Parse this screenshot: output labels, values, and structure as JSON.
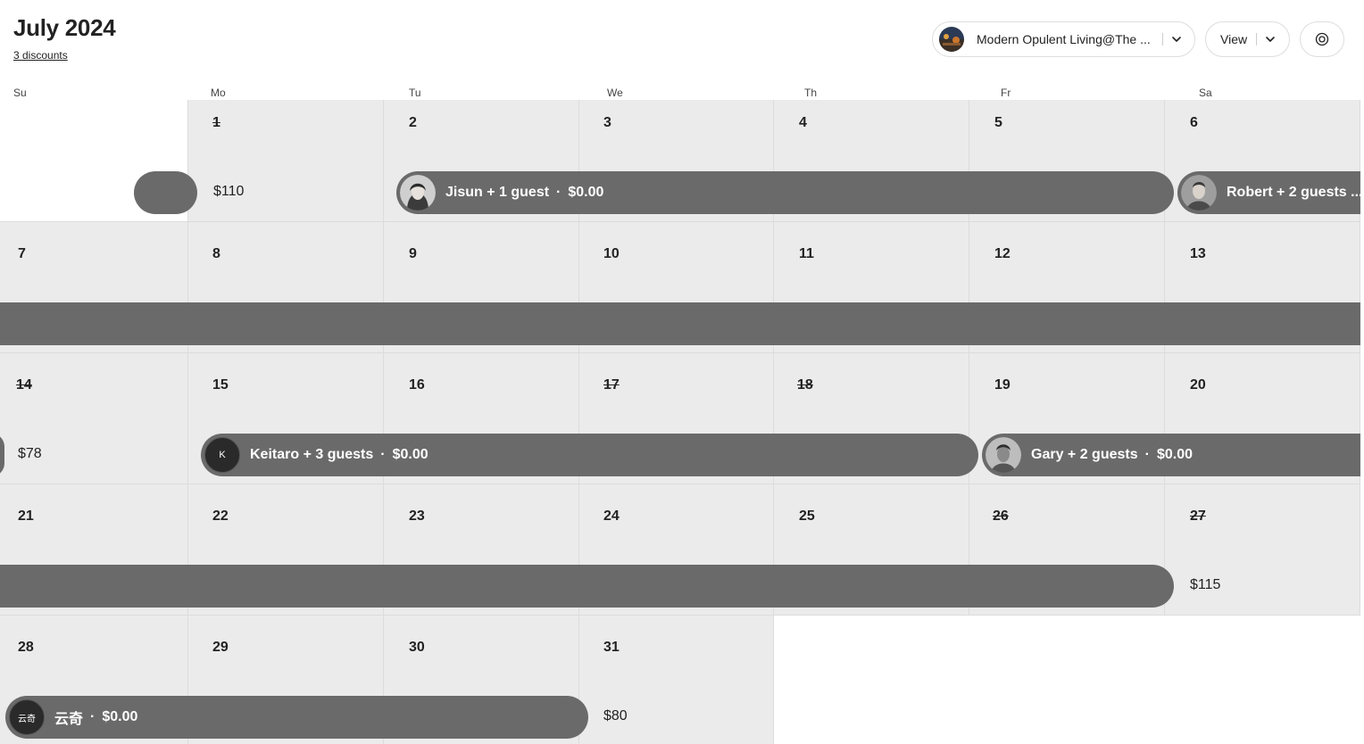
{
  "header": {
    "title": "July 2024",
    "discounts_link": "3 discounts",
    "listing_name": "Modern Opulent Living@The ...",
    "view_label": "View"
  },
  "weekdays": [
    "Su",
    "Mo",
    "Tu",
    "We",
    "Th",
    "Fr",
    "Sa"
  ],
  "days": [
    {
      "day": "1",
      "blocked": true,
      "price": "$110"
    },
    {
      "day": "2"
    },
    {
      "day": "3"
    },
    {
      "day": "4"
    },
    {
      "day": "5"
    },
    {
      "day": "6"
    },
    {
      "day": "7"
    },
    {
      "day": "8"
    },
    {
      "day": "9"
    },
    {
      "day": "10"
    },
    {
      "day": "11"
    },
    {
      "day": "12"
    },
    {
      "day": "13"
    },
    {
      "day": "14",
      "blocked": true,
      "price": "$78"
    },
    {
      "day": "15"
    },
    {
      "day": "16"
    },
    {
      "day": "17",
      "blocked": true
    },
    {
      "day": "18",
      "blocked": true
    },
    {
      "day": "19"
    },
    {
      "day": "20"
    },
    {
      "day": "21"
    },
    {
      "day": "22"
    },
    {
      "day": "23"
    },
    {
      "day": "24"
    },
    {
      "day": "25"
    },
    {
      "day": "26",
      "blocked": true
    },
    {
      "day": "27",
      "blocked": true,
      "price": "$115"
    },
    {
      "day": "28"
    },
    {
      "day": "29"
    },
    {
      "day": "30"
    },
    {
      "day": "31",
      "price": "$80"
    }
  ],
  "reservations": [
    {
      "guest": "Jisun + 1 guest",
      "amount": "$0.00",
      "avatar": "photo"
    },
    {
      "guest": "Robert + 2 guests ...",
      "amount": "",
      "avatar": "photo"
    },
    {
      "guest": "",
      "amount": "",
      "avatar": "none"
    },
    {
      "guest": "Keitaro + 3 guests",
      "amount": "$0.00",
      "avatar": "initial",
      "initial": "K"
    },
    {
      "guest": "Gary + 2 guests",
      "amount": "$0.00",
      "avatar": "photo"
    },
    {
      "guest": "",
      "amount": "",
      "avatar": "none"
    },
    {
      "guest": "云奇",
      "amount": "$0.00",
      "avatar": "initial",
      "initial": "云奇"
    }
  ],
  "dot_separator": "·",
  "colors": {
    "reservation_bar": "#6a6a6a",
    "cell_background": "#ebebeb",
    "text": "#222222"
  },
  "icons": {
    "listing_dropdown": "chevron-down-icon",
    "view_dropdown": "chevron-down-icon",
    "settings": "settings-icon"
  }
}
